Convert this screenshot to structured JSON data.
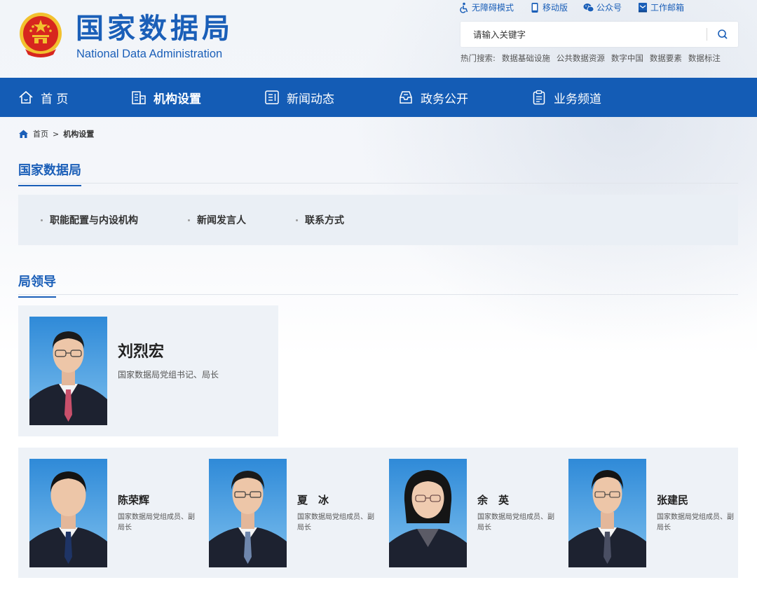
{
  "header": {
    "logo_cn": "国家数据局",
    "logo_en": "National Data Administration",
    "top_links": [
      {
        "label": "无障碍模式",
        "icon": "wheelchair-icon"
      },
      {
        "label": "移动版",
        "icon": "mobile-icon"
      },
      {
        "label": "公众号",
        "icon": "wechat-icon"
      },
      {
        "label": "工作邮箱",
        "icon": "mail-icon"
      }
    ],
    "search": {
      "placeholder": "请输入关键字"
    },
    "hot_label": "热门搜索:",
    "hot_keywords": [
      "数据基础设施",
      "公共数据资源",
      "数字中国",
      "数据要素",
      "数据标注"
    ]
  },
  "nav": {
    "items": [
      {
        "label": "首 页",
        "icon": "home-icon"
      },
      {
        "label": "机构设置",
        "icon": "building-icon"
      },
      {
        "label": "新闻动态",
        "icon": "news-icon"
      },
      {
        "label": "政务公开",
        "icon": "inbox-icon"
      },
      {
        "label": "业务频道",
        "icon": "clipboard-icon"
      }
    ],
    "active": "机构设置"
  },
  "breadcrumb": {
    "home": "首页",
    "separator": ">",
    "current": "机构设置"
  },
  "org": {
    "title": "国家数据局",
    "sub_links": [
      "职能配置与内设机构",
      "新闻发言人",
      "联系方式"
    ]
  },
  "leaders": {
    "title": "局领导",
    "chief": {
      "name": "刘烈宏",
      "title": "国家数据局党组书记、局长"
    },
    "deputies": [
      {
        "name": "陈荣辉",
        "title": "国家数据局党组成员、副局长"
      },
      {
        "name": "夏　冰",
        "title": "国家数据局党组成员、副局长"
      },
      {
        "name": "余　英",
        "title": "国家数据局党组成员、副局长"
      },
      {
        "name": "张建民",
        "title": "国家数据局党组成员、副局长"
      }
    ]
  },
  "colors": {
    "primary": "#145cb5",
    "brand_text": "#1b5fb8",
    "panel": "#eef2f7",
    "emblem_red": "#d7261e",
    "emblem_gold": "#f2c12e"
  }
}
